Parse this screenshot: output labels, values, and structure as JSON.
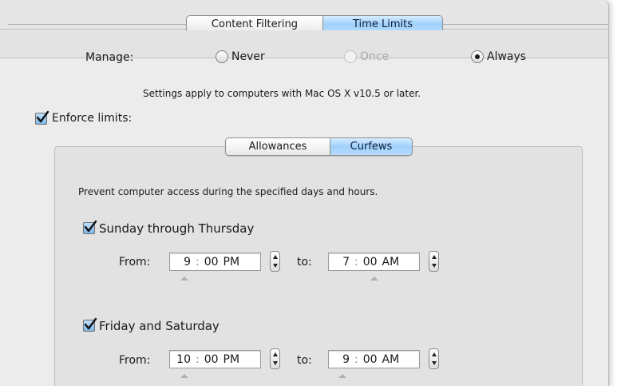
{
  "tabs": [
    {
      "label": "Content Filtering",
      "selected": false
    },
    {
      "label": "Time Limits",
      "selected": true
    }
  ],
  "manage": {
    "label": "Manage:",
    "options": [
      {
        "label": "Never",
        "checked": false,
        "enabled": true
      },
      {
        "label": "Once",
        "checked": false,
        "enabled": false
      },
      {
        "label": "Always",
        "checked": true,
        "enabled": true
      }
    ]
  },
  "settings_note": "Settings apply to computers with Mac OS X v10.5 or later.",
  "enforce": {
    "label": "Enforce limits:",
    "checked": true
  },
  "subtabs": [
    {
      "label": "Allowances",
      "selected": false
    },
    {
      "label": "Curfews",
      "selected": true
    }
  ],
  "curfews": {
    "description": "Prevent computer access during the specified days and hours.",
    "weeknight": {
      "label": "Sunday through Thursday",
      "checked": true,
      "from_label": "From:",
      "to_label": "to:",
      "from": {
        "hour": "9",
        "minute": "00",
        "ampm": "PM"
      },
      "to": {
        "hour": "7",
        "minute": "00",
        "ampm": "AM"
      }
    },
    "weekend": {
      "label": "Friday and Saturday",
      "checked": true,
      "from_label": "From:",
      "to_label": "to:",
      "from": {
        "hour": "10",
        "minute": "00",
        "ampm": "PM"
      },
      "to": {
        "hour": "9",
        "minute": "00",
        "ampm": "AM"
      }
    }
  },
  "icons": {
    "checkmark": "checkmark-icon",
    "stepper": "stepper-arrows-icon",
    "radio": "radio-icon"
  }
}
